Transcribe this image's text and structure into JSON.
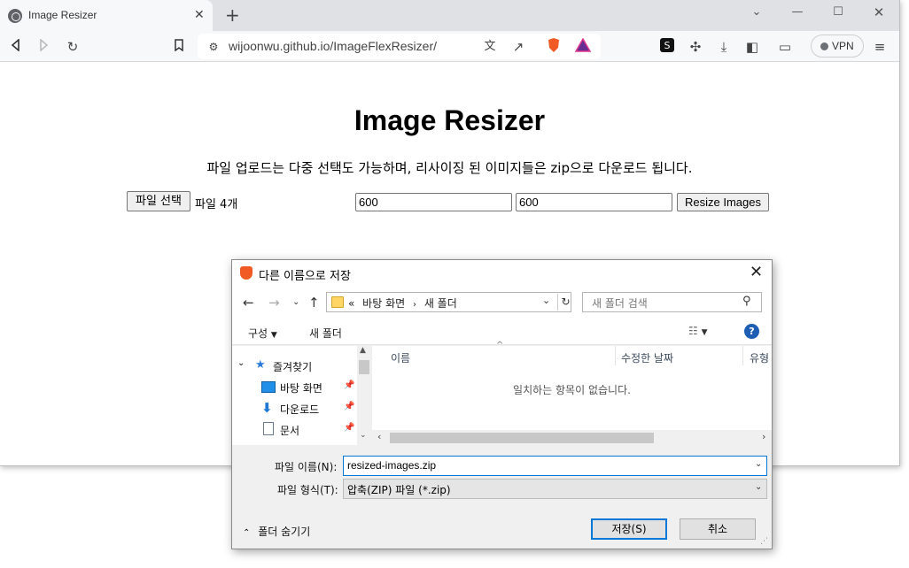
{
  "browser": {
    "tab_title": "Image Resizer",
    "url": "wijoonwu.github.io/ImageFlexResizer/",
    "vpn_label": "VPN",
    "icons": [
      "back-icon",
      "forward-icon",
      "reload-icon",
      "bookmark-icon",
      "site-info-icon",
      "translate-icon",
      "share-icon",
      "brave-shields-icon",
      "brave-rewards-icon",
      "extension-s-icon",
      "extensions-icon",
      "download-icon",
      "sidebar-icon",
      "wallet-icon",
      "menu-icon"
    ]
  },
  "page": {
    "title": "Image Resizer",
    "description": "파일 업로드는 다중 선택도 가능하며, 리사이징 된 이미지들은 zip으로 다운로드 됩니다.",
    "file_button": "파일 선택",
    "file_status": "파일 4개",
    "width_value": "600",
    "height_value": "600",
    "resize_button": "Resize Images"
  },
  "dialog": {
    "title": "다른 이름으로 저장",
    "breadcrumb_prefix": "«",
    "breadcrumb": [
      "바탕 화면",
      "새 폴더"
    ],
    "search_placeholder": "새 폴더 검색",
    "organize_label": "구성",
    "new_folder_label": "새 폴더",
    "nav_items": [
      {
        "label": "즐겨찾기",
        "icon": "star-icon"
      },
      {
        "label": "바탕 화면",
        "icon": "desktop-icon"
      },
      {
        "label": "다운로드",
        "icon": "download-arrow-icon"
      },
      {
        "label": "문서",
        "icon": "document-icon"
      }
    ],
    "columns": [
      "이름",
      "수정한 날짜",
      "유형"
    ],
    "empty_message": "일치하는 항목이 없습니다.",
    "filename_label": "파일 이름(N):",
    "filename_value": "resized-images.zip",
    "filetype_label": "파일 형식(T):",
    "filetype_value": "압축(ZIP) 파일 (*.zip)",
    "hide_folders_label": "폴더 숨기기",
    "save_button": "저장(S)",
    "cancel_button": "취소",
    "accent_color": "#0078d7"
  }
}
